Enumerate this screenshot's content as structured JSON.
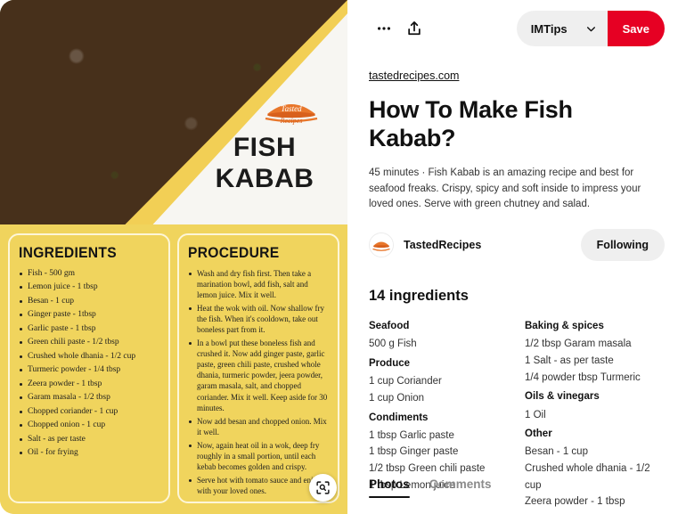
{
  "header": {
    "more_icon": "ellipsis-icon",
    "share_icon": "share-upload-icon",
    "board_name": "IMTips",
    "chevron_icon": "chevron-down-icon",
    "save_label": "Save",
    "save_color": "#e60023"
  },
  "pin": {
    "source": "tastedrecipes.com",
    "title": "How To Make Fish Kabab?",
    "description": "45 minutes · Fish Kabab is an amazing recipe and best for seafood freaks. Crispy, spicy and soft inside to impress your loved ones. Serve with green chutney and salad.",
    "author": "TastedRecipes",
    "follow_label": "Following"
  },
  "media": {
    "brand": "Tasted Recipes",
    "title_line1": "FISH",
    "title_line2": "KABAB",
    "background_yellow": "#f0d45d",
    "band_yellow": "#f2cf55",
    "lens_icon": "visual-search-lens-icon",
    "ingredients_card": {
      "heading": "INGREDIENTS",
      "items": [
        "Fish - 500 gm",
        "Lemon juice - 1 tbsp",
        "Besan - 1 cup",
        "Ginger paste - 1tbsp",
        "Garlic paste - 1 tbsp",
        "Green chili paste - 1/2 tbsp",
        "Crushed whole dhania - 1/2 cup",
        "Turmeric powder - 1/4 tbsp",
        "Zeera powder - 1 tbsp",
        "Garam masala - 1/2 tbsp",
        "Chopped coriander - 1 cup",
        "Chopped onion - 1 cup",
        "Salt - as per taste",
        "Oil - for frying"
      ]
    },
    "procedure_card": {
      "heading": "PROCEDURE",
      "steps": [
        "Wash and dry fish first. Then take a marination bowl, add fish, salt and lemon juice. Mix it well.",
        "Heat the wok with oil. Now shallow fry the fish.  When it's cooldown, take out boneless part from it.",
        "In a bowl put these boneless fish and crushed it. Now add ginger paste, garlic paste, green chili paste, crushed whole dhania, turmeric powder, jeera powder, garam masala, salt, and chopped coriander. Mix it well. Keep aside for 30 minutes.",
        "Now add besan and chopped onion. Mix it well.",
        "Now, again heat oil in a wok, deep fry roughly in a small portion, until each kebab becomes golden and crispy.",
        "Serve hot with tomato sauce and enjoy it with your loved ones."
      ]
    }
  },
  "ingredients": {
    "heading": "14 ingredients",
    "columns": [
      {
        "groups": [
          {
            "title": "Seafood",
            "items": [
              "500 g Fish"
            ]
          },
          {
            "title": "Produce",
            "items": [
              "1 cup Coriander",
              "1 cup Onion"
            ]
          },
          {
            "title": "Condiments",
            "items": [
              "1 tbsp Garlic paste",
              "1 tbsp Ginger paste",
              "1/2 tbsp Green chili paste",
              "1 tbsp Lemon juice"
            ]
          }
        ]
      },
      {
        "groups": [
          {
            "title": "Baking & spices",
            "items": [
              "1/2 tbsp Garam masala",
              "1 Salt - as per taste",
              "1/4 powder tbsp Turmeric"
            ]
          },
          {
            "title": "Oils & vinegars",
            "items": [
              "1 Oil"
            ]
          },
          {
            "title": "Other",
            "items": [
              "Besan - 1 cup",
              "Crushed whole dhania - 1/2 cup",
              "Zeera powder - 1 tbsp"
            ]
          }
        ]
      }
    ]
  },
  "tabs": [
    {
      "label": "Photos",
      "active": true
    },
    {
      "label": "Comments",
      "active": false
    }
  ]
}
